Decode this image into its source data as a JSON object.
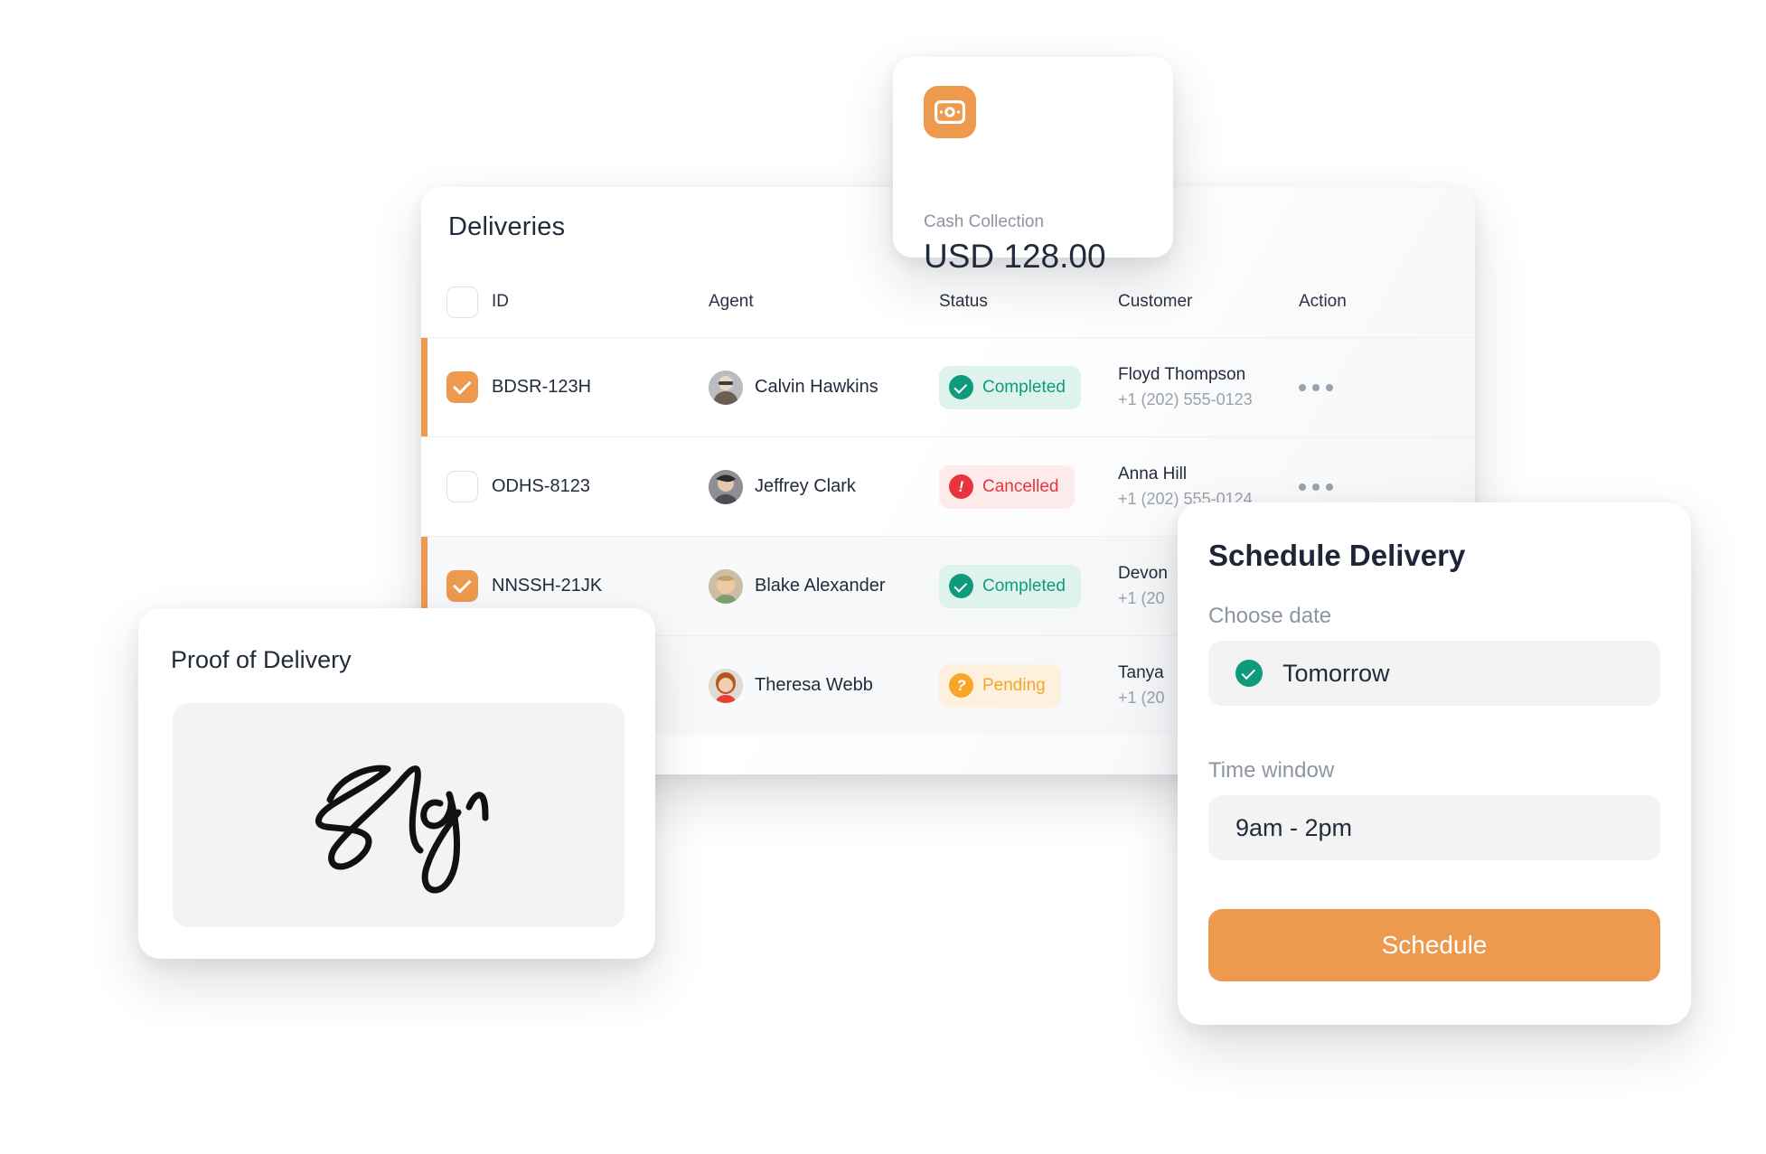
{
  "deliveries": {
    "title": "Deliveries",
    "columns": {
      "id": "ID",
      "agent": "Agent",
      "status": "Status",
      "customer": "Customer",
      "action": "Action"
    },
    "rows": [
      {
        "id": "BDSR-123H",
        "agent": "Calvin Hawkins",
        "status": "Completed",
        "status_type": "completed",
        "customer_name": "Floyd Thompson",
        "customer_phone": "+1 (202) 555-0123",
        "checked": true
      },
      {
        "id": "ODHS-8123",
        "agent": "Jeffrey Clark",
        "status": "Cancelled",
        "status_type": "cancelled",
        "customer_name": "Anna Hill",
        "customer_phone": "+1 (202) 555-0124",
        "checked": false
      },
      {
        "id": "NNSSH-21JK",
        "agent": "Blake Alexander",
        "status": "Completed",
        "status_type": "completed",
        "customer_name": "Devon",
        "customer_phone": "+1 (20",
        "checked": true
      },
      {
        "id": "",
        "agent": "Theresa Webb",
        "status": "Pending",
        "status_type": "pending",
        "customer_name": "Tanya",
        "customer_phone": "+1 (20",
        "checked": false
      }
    ]
  },
  "cash_collection": {
    "label": "Cash Collection",
    "amount": "USD 128.00",
    "icon": "banknote-icon"
  },
  "proof_of_delivery": {
    "title": "Proof of Delivery",
    "signature": "handwritten-signature"
  },
  "schedule_delivery": {
    "title": "Schedule Delivery",
    "date_label": "Choose date",
    "date_value": "Tomorrow",
    "time_label": "Time window",
    "time_value": "9am - 2pm",
    "submit_label": "Schedule"
  },
  "colors": {
    "accent_orange": "#ED9A4E",
    "completed_green": "#0E9B7C",
    "completed_bg": "#DFF3ED",
    "cancelled_red": "#E8353D",
    "cancelled_bg": "#FDEAEA",
    "pending_orange": "#F7A52B",
    "pending_bg": "#FDF0DC",
    "text_dark": "#222B3D",
    "text_muted": "#8D95A1"
  }
}
